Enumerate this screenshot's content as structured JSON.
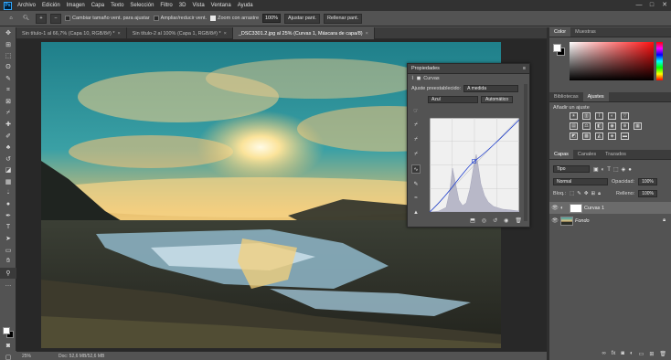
{
  "app": {
    "logo": "Ps"
  },
  "menu": [
    "Archivo",
    "Edición",
    "Imagen",
    "Capa",
    "Texto",
    "Selección",
    "Filtro",
    "3D",
    "Vista",
    "Ventana",
    "Ayuda"
  ],
  "window_controls": {
    "minimize": "—",
    "maximize": "□",
    "close": "✕"
  },
  "options_bar": {
    "resize_label": "Cambiar tamaño vent. para ajustar",
    "zoom_all_label": "Ampliar/reducir vent.",
    "scrubby_zoom_label": "Zoom con arrastre",
    "zoom_value": "100%",
    "fit_screen_label": "Ajustar pant.",
    "fill_screen_label": "Rellenar pant."
  },
  "tabs": [
    {
      "label": "Sin título-1 al 66,7% (Capa 10, RGB/8#) *",
      "close": "×",
      "active": false
    },
    {
      "label": "Sin título-2 al 100% (Capa 1, RGB/8#) *",
      "close": "×",
      "active": false
    },
    {
      "label": "_DSC3301.2.jpg al 25% (Curvas 1, Máscara de capa/8)",
      "close": "×",
      "active": true
    }
  ],
  "status": {
    "zoom": "25%",
    "doc_info": "Doc: 52,6 MB/52,6 MB"
  },
  "properties": {
    "title": "Propiedades",
    "adjustment_name": "Curvas",
    "preset_label": "Ajuste preestablecido:",
    "preset_value": "A medida",
    "channel_value": "Azul",
    "auto_label": "Automático"
  },
  "color_panel": {
    "tabs": [
      "Color",
      "Muestras"
    ]
  },
  "adjustments_panel": {
    "tabs": [
      "Bibliotecas",
      "Ajustes"
    ],
    "add_label": "Añadir un ajuste"
  },
  "layers_panel": {
    "tabs": [
      "Capas",
      "Canales",
      "Trazados"
    ],
    "filter_label": "Tipo",
    "blend_mode": "Normal",
    "opacity_label": "Opacidad:",
    "opacity_value": "100%",
    "lock_label": "Bloq.:",
    "fill_label": "Relleno:",
    "fill_value": "100%",
    "layers": [
      {
        "name": "Curvas 1",
        "selected": true
      },
      {
        "name": "Fondo",
        "selected": false
      }
    ]
  },
  "colors": {
    "accent": "#31a8ff",
    "panel": "#535353",
    "dark": "#323232"
  }
}
